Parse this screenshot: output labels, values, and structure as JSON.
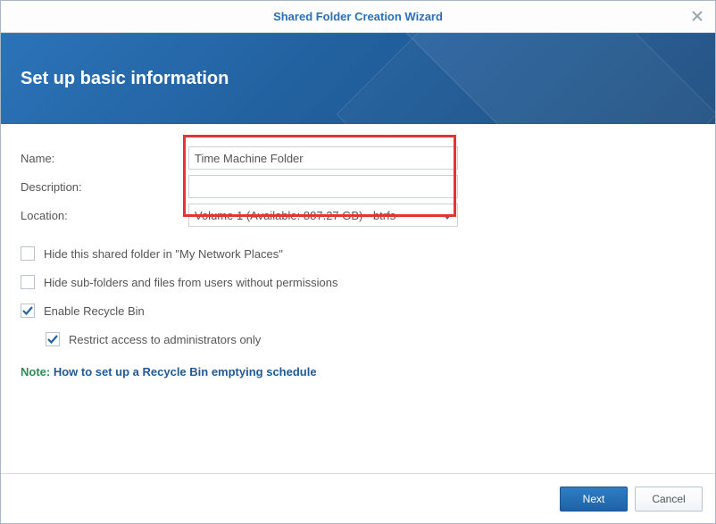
{
  "window": {
    "title": "Shared Folder Creation Wizard"
  },
  "header": {
    "title": "Set up basic information"
  },
  "form": {
    "name": {
      "label": "Name:",
      "value": "Time Machine Folder"
    },
    "description": {
      "label": "Description:",
      "value": ""
    },
    "location": {
      "label": "Location:",
      "selected": "Volume 1 (Available: 887.27 GB) - btrfs"
    },
    "options": {
      "hide_network": {
        "label": "Hide this shared folder in \"My Network Places\"",
        "checked": false
      },
      "hide_subfolders": {
        "label": "Hide sub-folders and files from users without permissions",
        "checked": false
      },
      "recycle_bin": {
        "label": "Enable Recycle Bin",
        "checked": true
      },
      "restrict_admin": {
        "label": "Restrict access to administrators only",
        "checked": true
      }
    },
    "note": {
      "label": "Note:",
      "link_text": "How to set up a Recycle Bin emptying schedule"
    }
  },
  "footer": {
    "next": "Next",
    "cancel": "Cancel"
  }
}
